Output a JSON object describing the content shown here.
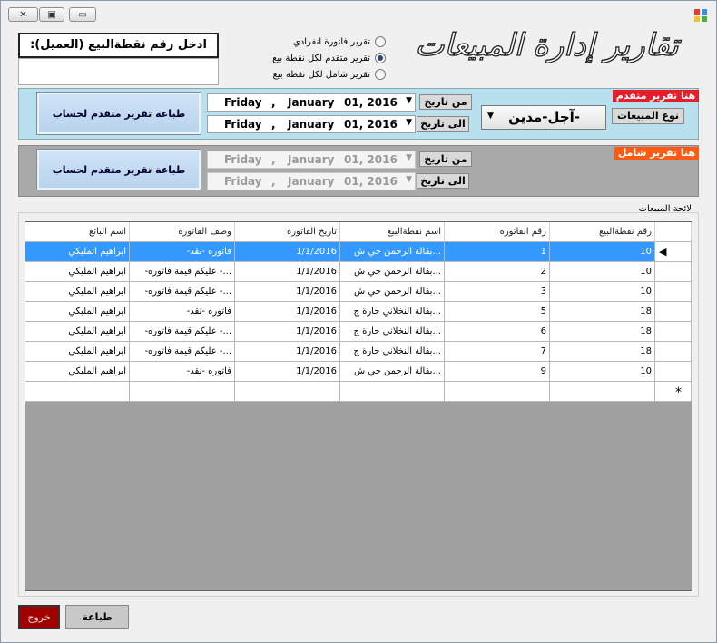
{
  "titlebar": {
    "icons": [
      "close-icon",
      "restore-icon",
      "minimize-icon"
    ]
  },
  "header": {
    "title": "تقارير إدارة المبيعات"
  },
  "report_type": {
    "options": [
      {
        "label": "تقرير فاتورة انفرادي",
        "selected": false
      },
      {
        "label": "تقرير متقدم لكل نقطة بيع",
        "selected": true
      },
      {
        "label": "تقرير شامل لكل نقطة بيع",
        "selected": false
      }
    ]
  },
  "customer": {
    "label": "ادخل رقم نقطةالبيع (العميل):",
    "value": ""
  },
  "advanced": {
    "tag": "هنا تقرير متقدم",
    "sales_type_label": "نوع المبيعات",
    "sales_type_value": "-آجل-مدين",
    "from_label": "من تاريخ",
    "to_label": "الى تاريخ",
    "from_date": {
      "day": "Friday",
      "sep": ",",
      "month": "January",
      "dd": "01, 2016"
    },
    "to_date": {
      "day": "Friday",
      "sep": ",",
      "month": "January",
      "dd": "01, 2016"
    },
    "print_button": "طباعة تقرير متقدم لحساب",
    "accent": "#b9e0ee"
  },
  "comprehensive": {
    "tag": "هنا تقرير شامل",
    "from_label": "من تاريخ",
    "to_label": "الى تاريخ",
    "from_date": {
      "day": "Friday",
      "sep": ",",
      "month": "January",
      "dd": "01, 2016"
    },
    "to_date": {
      "day": "Friday",
      "sep": ",",
      "month": "January",
      "dd": "01, 2016"
    },
    "print_button": "طباعة تقرير متقدم لحساب"
  },
  "sales_list": {
    "label": "لائحة المبيعات",
    "columns": [
      "رقم نقطةالبيع",
      "رقم الفاتوره",
      "اسم نقطةالبيع",
      "تاريخ الفاتوره",
      "وصف الفاتوره",
      "اسم البائع"
    ],
    "rows": [
      [
        "10",
        "1",
        "بقالة الرحمن حي ش...",
        "1/1/2016",
        "-فاتوره -نقد",
        "ابراهيم المليكي"
      ],
      [
        "10",
        "2",
        "بقالة الرحمن حي ش...",
        "1/1/2016",
        "-عليكم قيمة فاتوره -...",
        "ابراهيم المليكي"
      ],
      [
        "10",
        "3",
        "بقالة الرحمن حي ش...",
        "1/1/2016",
        "-عليكم قيمة فاتوره -...",
        "ابراهيم المليكي"
      ],
      [
        "18",
        "5",
        "بقالة النخلاني حارة ج...",
        "1/1/2016",
        "-فاتوره -نقد",
        "ابراهيم المليكي"
      ],
      [
        "18",
        "6",
        "بقالة النخلاني حارة ج...",
        "1/1/2016",
        "-عليكم قيمة فاتوره -...",
        "ابراهيم المليكي"
      ],
      [
        "18",
        "7",
        "بقالة النخلاني حارة ج...",
        "1/1/2016",
        "-عليكم قيمة فاتوره -...",
        "ابراهيم المليكي"
      ],
      [
        "10",
        "9",
        "بقالة الرحمن حي ش...",
        "1/1/2016",
        "-فاتوره -نقد",
        "ابراهيم المليكي"
      ]
    ],
    "selected_row": 0,
    "new_row_marker": "*",
    "current_row_marker": "◀"
  },
  "footer": {
    "exit_button": "خروج",
    "print_button": "طباعة"
  },
  "colors": {
    "selected_row": "#3399ff",
    "tag_red": "#e61d2a",
    "tag_orange": "#ff5a14",
    "exit": "#a00000"
  }
}
